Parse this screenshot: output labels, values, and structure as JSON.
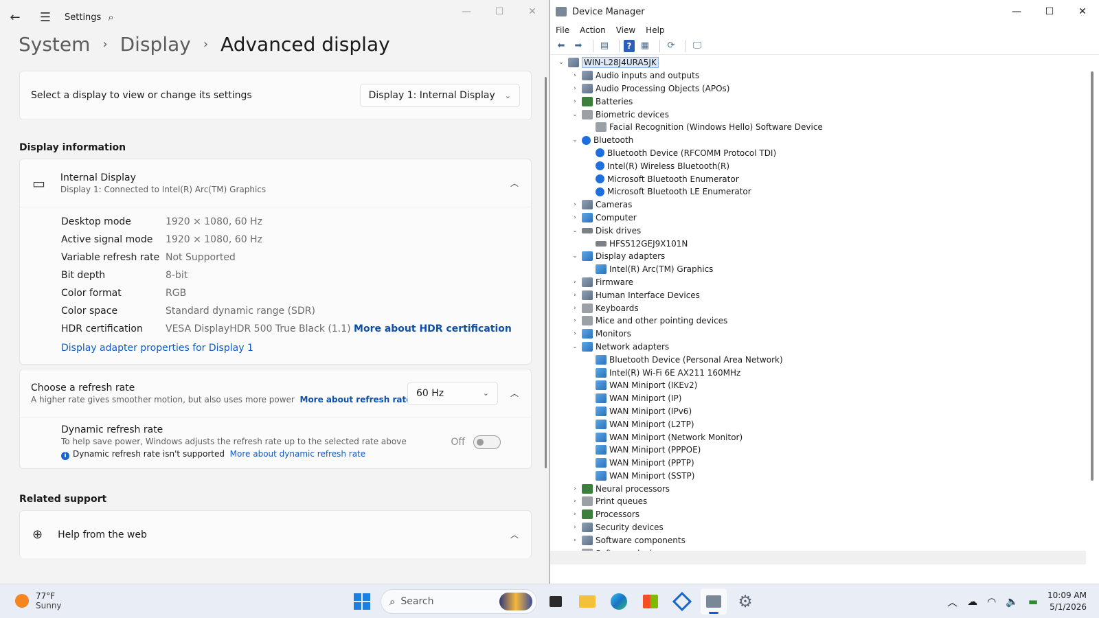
{
  "settings": {
    "app_title": "Settings",
    "breadcrumb": [
      "System",
      "Display",
      "Advanced display"
    ],
    "select_display_label": "Select a display to view or change its settings",
    "selected_display": "Display 1: Internal Display",
    "display_info_title": "Display information",
    "display_name": "Internal Display",
    "display_connection": "Display 1: Connected to Intel(R) Arc(TM) Graphics",
    "info_rows": [
      {
        "key": "Desktop mode",
        "value": "1920 × 1080, 60 Hz"
      },
      {
        "key": "Active signal mode",
        "value": "1920 × 1080, 60 Hz"
      },
      {
        "key": "Variable refresh rate",
        "value": "Not Supported"
      },
      {
        "key": "Bit depth",
        "value": "8-bit"
      },
      {
        "key": "Color format",
        "value": "RGB"
      },
      {
        "key": "Color space",
        "value": "Standard dynamic range (SDR)"
      },
      {
        "key": "HDR certification",
        "value": "VESA DisplayHDR 500 True Black (1.1)"
      }
    ],
    "hdr_link": "More about HDR certification",
    "adapter_link": "Display adapter properties for Display 1",
    "refresh_title": "Choose a refresh rate",
    "refresh_desc": "A higher rate gives smoother motion, but also uses more power",
    "refresh_link": "More about refresh rate",
    "refresh_value": "60 Hz",
    "dynamic_title": "Dynamic refresh rate",
    "dynamic_desc": "To help save power, Windows adjusts the refresh rate up to the selected rate above",
    "dynamic_note": "Dynamic refresh rate isn't supported",
    "dynamic_link": "More about dynamic refresh rate",
    "toggle_state": "Off",
    "related_title": "Related support",
    "help_web": "Help from the web"
  },
  "device_manager": {
    "title": "Device Manager",
    "menu": [
      "File",
      "Action",
      "View",
      "Help"
    ],
    "root": "WIN-L28J4URA5JK",
    "tree": [
      {
        "level": 1,
        "exp": "›",
        "icon": "gen",
        "label": "Audio inputs and outputs"
      },
      {
        "level": 1,
        "exp": "›",
        "icon": "gen",
        "label": "Audio Processing Objects (APOs)"
      },
      {
        "level": 1,
        "exp": "›",
        "icon": "green",
        "label": "Batteries"
      },
      {
        "level": 1,
        "exp": "⌄",
        "icon": "gray",
        "label": "Biometric devices"
      },
      {
        "level": 2,
        "exp": "",
        "icon": "gray",
        "label": "Facial Recognition (Windows Hello) Software Device"
      },
      {
        "level": 1,
        "exp": "⌄",
        "icon": "bt",
        "label": "Bluetooth"
      },
      {
        "level": 2,
        "exp": "",
        "icon": "bt",
        "label": "Bluetooth Device (RFCOMM Protocol TDI)"
      },
      {
        "level": 2,
        "exp": "",
        "icon": "bt",
        "label": "Intel(R) Wireless Bluetooth(R)"
      },
      {
        "level": 2,
        "exp": "",
        "icon": "bt",
        "label": "Microsoft Bluetooth Enumerator"
      },
      {
        "level": 2,
        "exp": "",
        "icon": "bt",
        "label": "Microsoft Bluetooth LE Enumerator"
      },
      {
        "level": 1,
        "exp": "›",
        "icon": "gen",
        "label": "Cameras"
      },
      {
        "level": 1,
        "exp": "›",
        "icon": "net",
        "label": "Computer"
      },
      {
        "level": 1,
        "exp": "⌄",
        "icon": "disk",
        "label": "Disk drives"
      },
      {
        "level": 2,
        "exp": "",
        "icon": "disk",
        "label": "HFS512GEJ9X101N"
      },
      {
        "level": 1,
        "exp": "⌄",
        "icon": "net",
        "label": "Display adapters"
      },
      {
        "level": 2,
        "exp": "",
        "icon": "net",
        "label": "Intel(R) Arc(TM) Graphics"
      },
      {
        "level": 1,
        "exp": "›",
        "icon": "gen",
        "label": "Firmware"
      },
      {
        "level": 1,
        "exp": "›",
        "icon": "gen",
        "label": "Human Interface Devices"
      },
      {
        "level": 1,
        "exp": "›",
        "icon": "gray",
        "label": "Keyboards"
      },
      {
        "level": 1,
        "exp": "›",
        "icon": "gray",
        "label": "Mice and other pointing devices"
      },
      {
        "level": 1,
        "exp": "›",
        "icon": "net",
        "label": "Monitors"
      },
      {
        "level": 1,
        "exp": "⌄",
        "icon": "net",
        "label": "Network adapters"
      },
      {
        "level": 2,
        "exp": "",
        "icon": "net",
        "label": "Bluetooth Device (Personal Area Network)"
      },
      {
        "level": 2,
        "exp": "",
        "icon": "net",
        "label": "Intel(R) Wi-Fi 6E AX211 160MHz"
      },
      {
        "level": 2,
        "exp": "",
        "icon": "net",
        "label": "WAN Miniport (IKEv2)"
      },
      {
        "level": 2,
        "exp": "",
        "icon": "net",
        "label": "WAN Miniport (IP)"
      },
      {
        "level": 2,
        "exp": "",
        "icon": "net",
        "label": "WAN Miniport (IPv6)"
      },
      {
        "level": 2,
        "exp": "",
        "icon": "net",
        "label": "WAN Miniport (L2TP)"
      },
      {
        "level": 2,
        "exp": "",
        "icon": "net",
        "label": "WAN Miniport (Network Monitor)"
      },
      {
        "level": 2,
        "exp": "",
        "icon": "net",
        "label": "WAN Miniport (PPPOE)"
      },
      {
        "level": 2,
        "exp": "",
        "icon": "net",
        "label": "WAN Miniport (PPTP)"
      },
      {
        "level": 2,
        "exp": "",
        "icon": "net",
        "label": "WAN Miniport (SSTP)"
      },
      {
        "level": 1,
        "exp": "›",
        "icon": "green",
        "label": "Neural processors"
      },
      {
        "level": 1,
        "exp": "›",
        "icon": "gray",
        "label": "Print queues"
      },
      {
        "level": 1,
        "exp": "›",
        "icon": "green",
        "label": "Processors"
      },
      {
        "level": 1,
        "exp": "›",
        "icon": "gen",
        "label": "Security devices"
      },
      {
        "level": 1,
        "exp": "›",
        "icon": "gen",
        "label": "Software components"
      },
      {
        "level": 1,
        "exp": "›",
        "icon": "gray",
        "label": "Software devices"
      }
    ]
  },
  "taskbar": {
    "temperature": "77°F",
    "condition": "Sunny",
    "search_label": "Search",
    "time": "10:09 AM",
    "date": "5/1/2026"
  }
}
